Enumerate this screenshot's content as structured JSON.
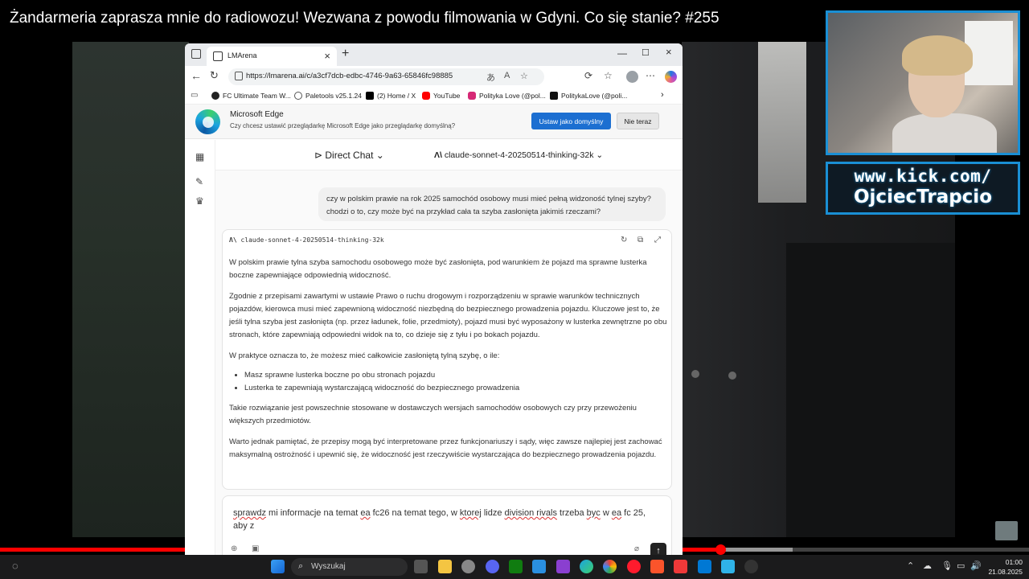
{
  "video": {
    "title": "Żandarmeria zaprasza mnie do radiowozu! Wezwana z powodu filmowania w Gdyni. Co się stanie? #255",
    "progress_fraction": 0.7,
    "buffered_fraction": 0.77
  },
  "overlay": {
    "kick_line1": "www.kick.com/",
    "kick_line2": "OjciecTrapcio"
  },
  "browser": {
    "tab_title": "LMArena",
    "new_tab": "+",
    "url": "https://lmarena.ai/c/a3cf7dcb-edbc-4746-9a63-65846fc98885",
    "bookmarks": [
      {
        "label": "FC Ultimate Team W...",
        "color": "#222222"
      },
      {
        "label": "Paletools v25.1.24",
        "color": "#555555"
      },
      {
        "label": "(2) Home / X",
        "color": "#000000"
      },
      {
        "label": "YouTube",
        "color": "#ff0000"
      },
      {
        "label": "Polityka Love (@pol...",
        "color": "#d62976"
      },
      {
        "label": "PolitykaLove (@poli...",
        "color": "#111111"
      }
    ],
    "infobar": {
      "title": "Microsoft Edge",
      "text": "Czy chcesz ustawić przeglądarkę Microsoft Edge jako przeglądarkę domyślną?",
      "primary_label": "Ustaw jako domyślny",
      "secondary_label": "Nie teraz"
    }
  },
  "app": {
    "mode_label": "Direct Chat",
    "model_label": "claude-sonnet-4-20250514-thinking-32k",
    "user_message": "czy w polskim prawie na rok 2025 samochód osobowy musi mieć pełną widzoność tylnej szyby? chodzi o to, czy może być na przykład cała ta szyba zasłonięta jakimiś rzeczami?",
    "answer_model": "claude-sonnet-4-20250514-thinking-32k",
    "answer_paragraphs": [
      "W polskim prawie tylna szyba samochodu osobowego może być zasłonięta, pod warunkiem że pojazd ma sprawne lusterka boczne zapewniające odpowiednią widoczność.",
      "Zgodnie z przepisami zawartymi w ustawie Prawo o ruchu drogowym i rozporządzeniu w sprawie warunków technicznych pojazdów, kierowca musi mieć zapewnioną widoczność niezbędną do bezpiecznego prowadzenia pojazdu. Kluczowe jest to, że jeśli tylna szyba jest zasłonięta (np. przez ładunek, folie, przedmioty), pojazd musi być wyposażony w lusterka zewnętrzne po obu stronach, które zapewniają odpowiedni widok na to, co dzieje się z tyłu i po bokach pojazdu.",
      "W praktyce oznacza to, że możesz mieć całkowicie zasłoniętą tylną szybę, o ile:"
    ],
    "answer_bullets": [
      "Masz sprawne lusterka boczne po obu stronach pojazdu",
      "Lusterka te zapewniają wystarczającą widoczność do bezpiecznego prowadzenia"
    ],
    "answer_tail": [
      "Takie rozwiązanie jest powszechnie stosowane w dostawczych wersjach samochodów osobowych czy przy przewożeniu większych przedmiotów.",
      "Warto jednak pamiętać, że przepisy mogą być interpretowane przez funkcjonariuszy i sądy, więc zawsze najlepiej jest zachować maksymalną ostrożność i upewnić się, że widoczność jest rzeczywiście wystarczająca do bezpiecznego prowadzenia pojazdu."
    ],
    "composer": {
      "w1": "sprawdz",
      "t1": " mi informacje na temat ",
      "w2": "ea",
      "t2": " fc26 na temat tego, w ",
      "w3": "ktorej",
      "t3": " lidze ",
      "w4": "division rivals",
      "t4": " trzeba ",
      "w5": "byc",
      "t5": " w ",
      "w6": "ea",
      "t6": " fc 25, aby z"
    }
  },
  "taskbar": {
    "search_placeholder": "Wyszukaj",
    "time": "01:00",
    "date": "21.08.2025"
  }
}
